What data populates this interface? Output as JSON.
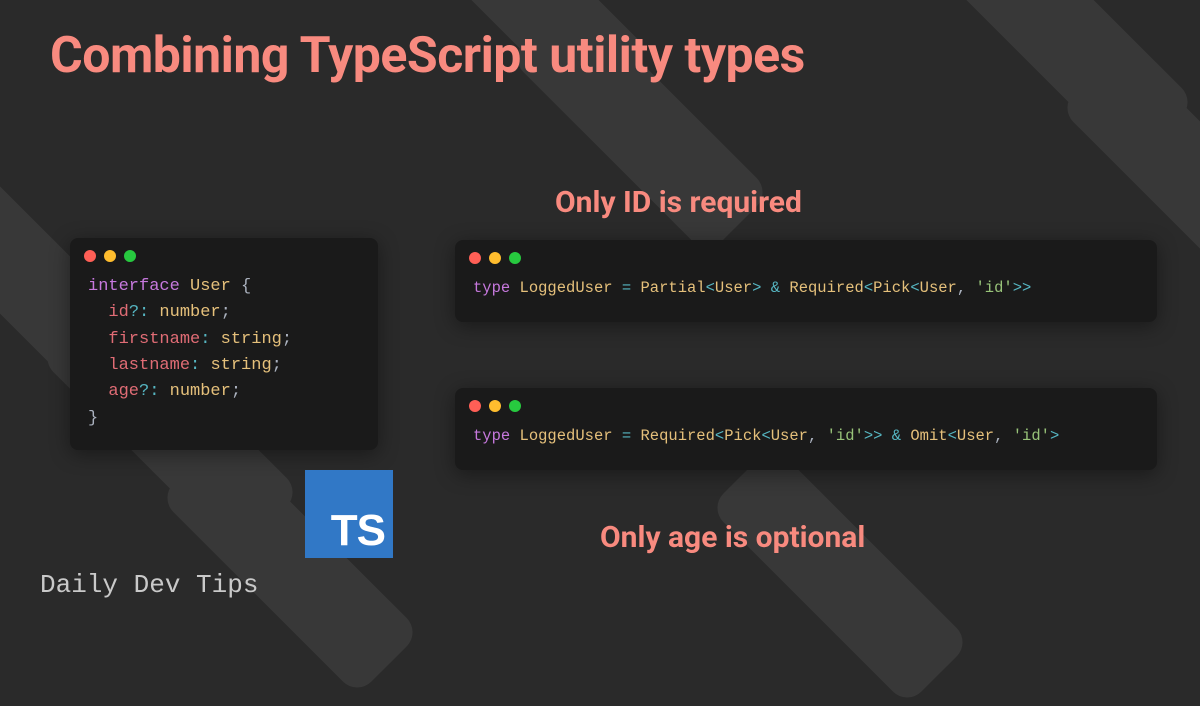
{
  "title": "Combining TypeScript utility types",
  "subtitle_top": "Only ID is required",
  "subtitle_bottom": "Only age is optional",
  "footer": "Daily Dev Tips",
  "ts_logo": "TS",
  "code_left": {
    "tokens": [
      {
        "t": "interface",
        "c": "kw"
      },
      {
        "t": " ",
        "c": ""
      },
      {
        "t": "User",
        "c": "typename"
      },
      {
        "t": " {",
        "c": "pn"
      },
      {
        "br": true
      },
      {
        "t": "  ",
        "c": ""
      },
      {
        "t": "id",
        "c": "prop"
      },
      {
        "t": "?:",
        "c": "op"
      },
      {
        "t": " ",
        "c": ""
      },
      {
        "t": "number",
        "c": "builtin"
      },
      {
        "t": ";",
        "c": "pn"
      },
      {
        "br": true
      },
      {
        "t": "  ",
        "c": ""
      },
      {
        "t": "firstname",
        "c": "prop"
      },
      {
        "t": ":",
        "c": "op"
      },
      {
        "t": " ",
        "c": ""
      },
      {
        "t": "string",
        "c": "builtin"
      },
      {
        "t": ";",
        "c": "pn"
      },
      {
        "br": true
      },
      {
        "t": "  ",
        "c": ""
      },
      {
        "t": "lastname",
        "c": "prop"
      },
      {
        "t": ":",
        "c": "op"
      },
      {
        "t": " ",
        "c": ""
      },
      {
        "t": "string",
        "c": "builtin"
      },
      {
        "t": ";",
        "c": "pn"
      },
      {
        "br": true
      },
      {
        "t": "  ",
        "c": ""
      },
      {
        "t": "age",
        "c": "prop"
      },
      {
        "t": "?:",
        "c": "op"
      },
      {
        "t": " ",
        "c": ""
      },
      {
        "t": "number",
        "c": "builtin"
      },
      {
        "t": ";",
        "c": "pn"
      },
      {
        "br": true
      },
      {
        "t": "}",
        "c": "pn"
      }
    ]
  },
  "code_right_1": {
    "tokens": [
      {
        "t": "type",
        "c": "kw"
      },
      {
        "t": " ",
        "c": ""
      },
      {
        "t": "LoggedUser",
        "c": "typename"
      },
      {
        "t": " ",
        "c": ""
      },
      {
        "t": "=",
        "c": "op"
      },
      {
        "t": " ",
        "c": ""
      },
      {
        "t": "Partial",
        "c": "builtin"
      },
      {
        "t": "<",
        "c": "op"
      },
      {
        "t": "User",
        "c": "typename"
      },
      {
        "t": ">",
        "c": "op"
      },
      {
        "t": " ",
        "c": ""
      },
      {
        "t": "&",
        "c": "op"
      },
      {
        "t": " ",
        "c": ""
      },
      {
        "t": "Required",
        "c": "builtin"
      },
      {
        "t": "<",
        "c": "op"
      },
      {
        "t": "Pick",
        "c": "builtin"
      },
      {
        "t": "<",
        "c": "op"
      },
      {
        "t": "User",
        "c": "typename"
      },
      {
        "t": ",",
        "c": "pn"
      },
      {
        "t": " ",
        "c": ""
      },
      {
        "t": "'id'",
        "c": "str"
      },
      {
        "t": ">>",
        "c": "op"
      }
    ]
  },
  "code_right_2": {
    "tokens": [
      {
        "t": "type",
        "c": "kw"
      },
      {
        "t": " ",
        "c": ""
      },
      {
        "t": "LoggedUser",
        "c": "typename"
      },
      {
        "t": " ",
        "c": ""
      },
      {
        "t": "=",
        "c": "op"
      },
      {
        "t": " ",
        "c": ""
      },
      {
        "t": "Required",
        "c": "builtin"
      },
      {
        "t": "<",
        "c": "op"
      },
      {
        "t": "Pick",
        "c": "builtin"
      },
      {
        "t": "<",
        "c": "op"
      },
      {
        "t": "User",
        "c": "typename"
      },
      {
        "t": ",",
        "c": "pn"
      },
      {
        "t": " ",
        "c": ""
      },
      {
        "t": "'id'",
        "c": "str"
      },
      {
        "t": ">>",
        "c": "op"
      },
      {
        "t": " ",
        "c": ""
      },
      {
        "t": "&",
        "c": "op"
      },
      {
        "t": " ",
        "c": ""
      },
      {
        "t": "Omit",
        "c": "builtin"
      },
      {
        "t": "<",
        "c": "op"
      },
      {
        "t": "User",
        "c": "typename"
      },
      {
        "t": ",",
        "c": "pn"
      },
      {
        "t": " ",
        "c": ""
      },
      {
        "t": "'id'",
        "c": "str"
      },
      {
        "t": ">",
        "c": "op"
      }
    ]
  }
}
